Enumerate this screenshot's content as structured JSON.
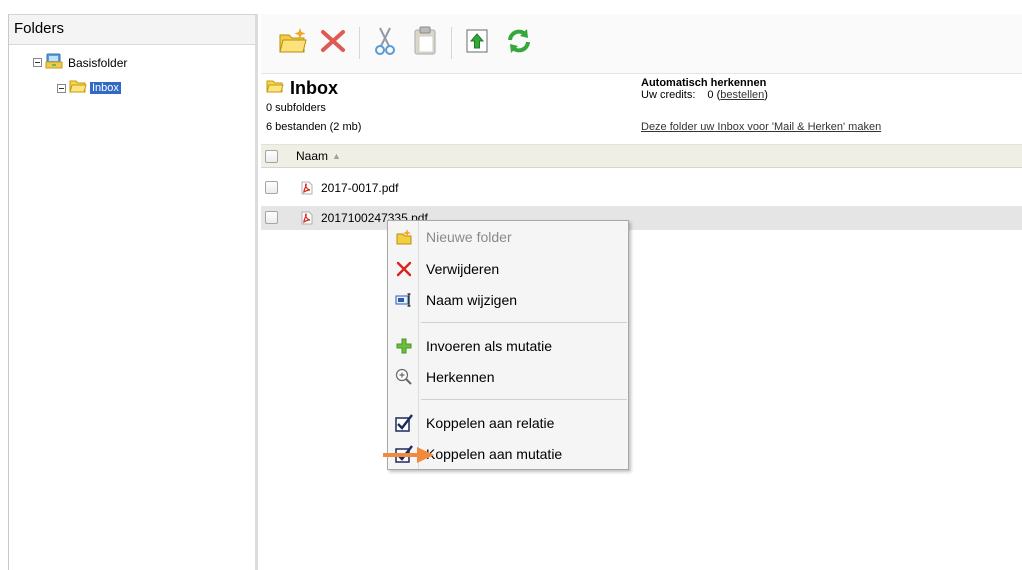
{
  "left_pane": {
    "title": "Folders",
    "tree": [
      {
        "label": "Basisfolder"
      },
      {
        "label": "Inbox"
      }
    ]
  },
  "toolbar": {
    "buttons": [
      "new-folder-icon",
      "delete-icon",
      "cut-icon",
      "paste-icon",
      "upload-icon",
      "refresh-icon"
    ]
  },
  "folder_info": {
    "title": "Inbox",
    "subfolders": "0 subfolders",
    "files": "6 bestanden (2 mb)",
    "auto_title": "Automatisch herkennen",
    "credits_label": "Uw credits:",
    "credits_value": "0 (",
    "credits_link": "bestellen",
    "credits_close": ")",
    "inbox_link": "Deze folder uw Inbox voor 'Mail & Herken' maken"
  },
  "file_list": {
    "column_name": "Naam",
    "files": [
      {
        "name": "2017-0017.pdf"
      },
      {
        "name": "2017100247335.pdf"
      }
    ]
  },
  "context_menu": {
    "items": [
      {
        "label": "Nieuwe folder",
        "icon": "new-folder-icon",
        "disabled": true
      },
      {
        "label": "Verwijderen",
        "icon": "delete-icon"
      },
      {
        "label": "Naam wijzigen",
        "icon": "rename-icon"
      },
      {
        "label": "Invoeren als mutatie",
        "icon": "plus-icon"
      },
      {
        "label": "Herkennen",
        "icon": "zoom-icon"
      },
      {
        "label": "Koppelen aan relatie",
        "icon": "checkbox-icon"
      },
      {
        "label": "Koppelen aan mutatie",
        "icon": "checkbox-icon"
      }
    ]
  },
  "colors": {
    "selection": "#316ac5",
    "delete_red": "#d9241c",
    "arrow_orange": "#f08a3c"
  }
}
